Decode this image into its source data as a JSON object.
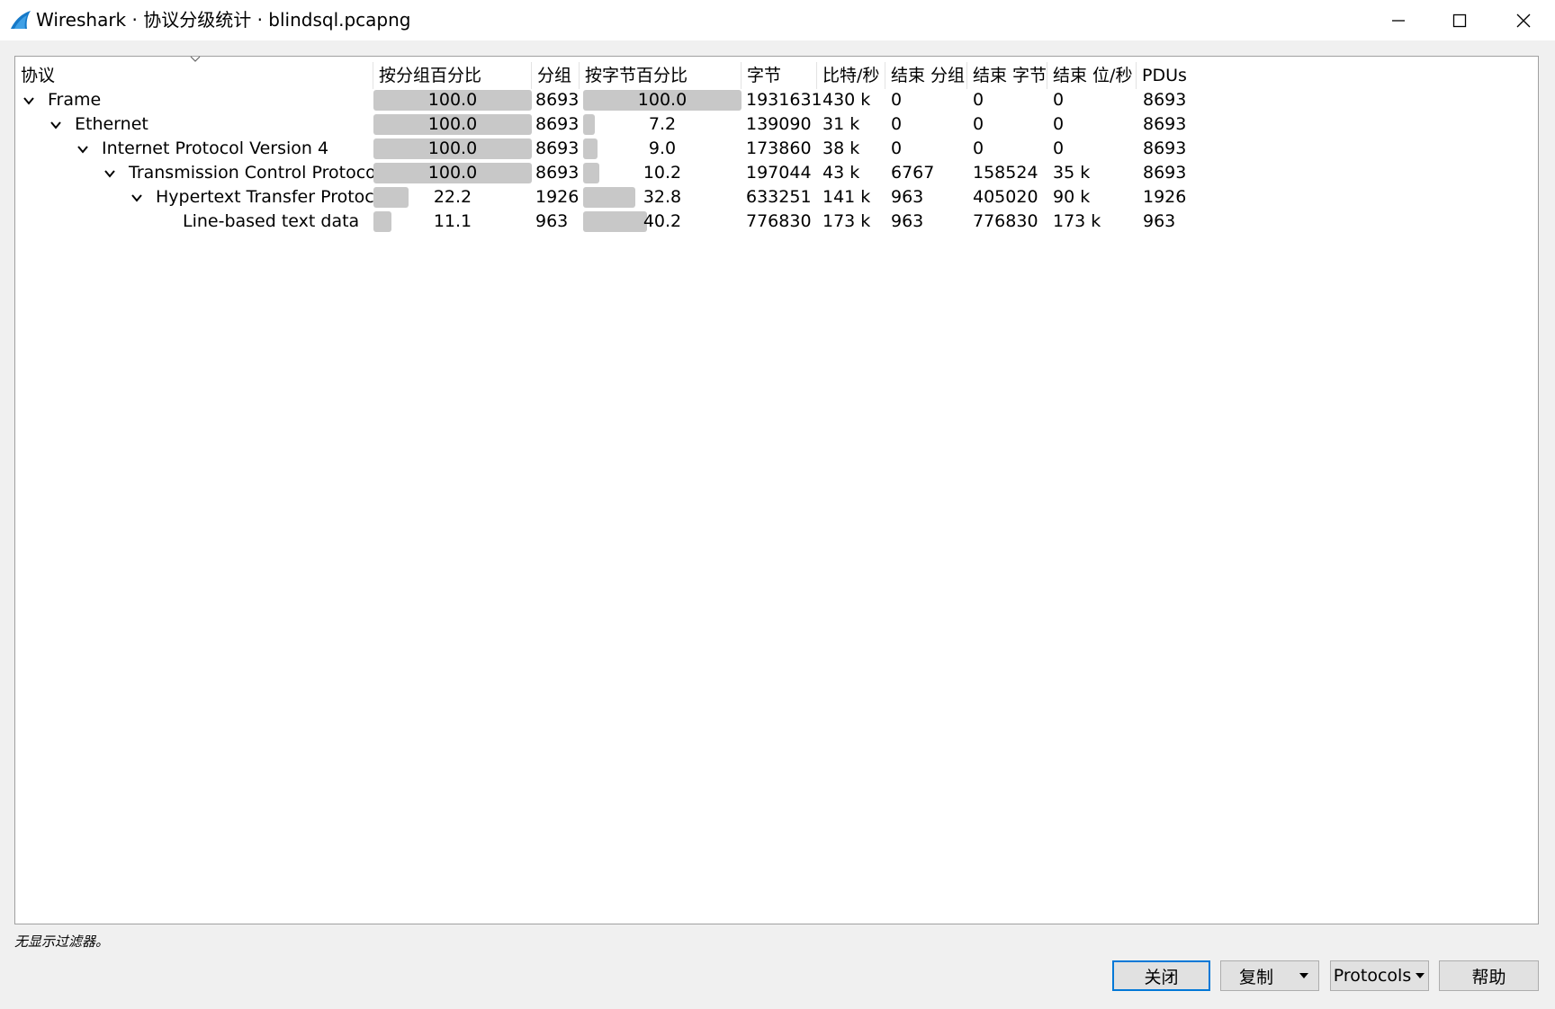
{
  "window": {
    "title": "Wireshark · 协议分级统计 · blindsql.pcapng"
  },
  "columns": [
    "协议",
    "按分组百分比",
    "分组",
    "按字节百分比",
    "字节",
    "比特/秒",
    "结束 分组",
    "结束 字节",
    "结束 位/秒",
    "PDUs"
  ],
  "rows": [
    {
      "protocol": "Frame",
      "pct_packets": "100.0",
      "packets": "8693",
      "pct_bytes": "100.0",
      "bytes": "1931631",
      "bps": "430 k",
      "end_packets": "0",
      "end_bytes": "0",
      "end_bps": "0",
      "pdus": "8693"
    },
    {
      "protocol": "Ethernet",
      "pct_packets": "100.0",
      "packets": "8693",
      "pct_bytes": "7.2",
      "bytes": "139090",
      "bps": "31 k",
      "end_packets": "0",
      "end_bytes": "0",
      "end_bps": "0",
      "pdus": "8693"
    },
    {
      "protocol": "Internet Protocol Version 4",
      "pct_packets": "100.0",
      "packets": "8693",
      "pct_bytes": "9.0",
      "bytes": "173860",
      "bps": "38 k",
      "end_packets": "0",
      "end_bytes": "0",
      "end_bps": "0",
      "pdus": "8693"
    },
    {
      "protocol": "Transmission Control Protocol",
      "pct_packets": "100.0",
      "packets": "8693",
      "pct_bytes": "10.2",
      "bytes": "197044",
      "bps": "43 k",
      "end_packets": "6767",
      "end_bytes": "158524",
      "end_bps": "35 k",
      "pdus": "8693"
    },
    {
      "protocol": "Hypertext Transfer Protocol",
      "pct_packets": "22.2",
      "packets": "1926",
      "pct_bytes": "32.8",
      "bytes": "633251",
      "bps": "141 k",
      "end_packets": "963",
      "end_bytes": "405020",
      "end_bps": "90 k",
      "pdus": "1926"
    },
    {
      "protocol": "Line-based text data",
      "pct_packets": "11.1",
      "packets": "963",
      "pct_bytes": "40.2",
      "bytes": "776830",
      "bps": "173 k",
      "end_packets": "963",
      "end_bytes": "776830",
      "end_bps": "173 k",
      "pdus": "963"
    }
  ],
  "status": {
    "filter_text": "无显示过滤器。"
  },
  "buttons": {
    "close": "关闭",
    "copy": "复制",
    "protocols": "Protocols",
    "help": "帮助"
  },
  "colors": {
    "bar": "#c8c8c8",
    "accent": "#0078d7",
    "titlebar": "#ffffff",
    "panel": "#ffffff"
  }
}
